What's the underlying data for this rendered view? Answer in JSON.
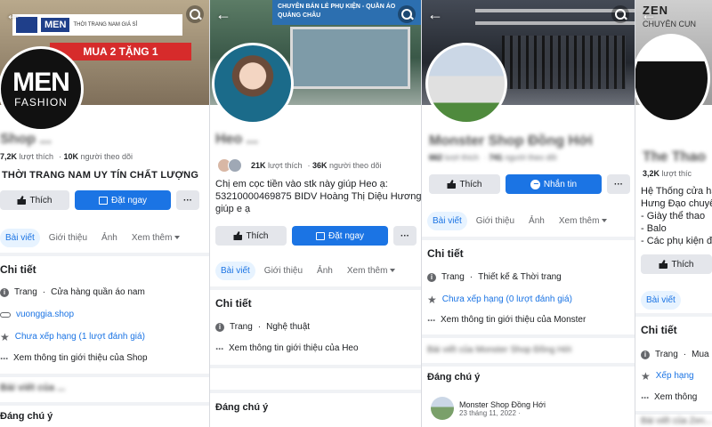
{
  "panels": [
    {
      "cover_sign_brand": "MEN",
      "cover_sign_text": "THỜI TRANG NAM GIÁ SỈ",
      "cover_promo": "MUA 2 TẶNG 1",
      "avatar_line1": "MEN",
      "avatar_line2": "FASHION",
      "page_name": "Shop ...",
      "likes_count": "7,2K",
      "likes_label": "lượt thích",
      "followers_count": "10K",
      "followers_label": "người theo dõi",
      "intro": "THỜI TRANG NAM UY TÍN CHẤT LƯỢNG",
      "like_btn": "Thích",
      "primary_btn": "Đặt ngay",
      "more_btn": "···",
      "tabs": [
        "Bài viết",
        "Giới thiệu",
        "Ảnh",
        "Xem thêm"
      ],
      "details_title": "Chi tiết",
      "details": {
        "category_prefix": "Trang",
        "category": "Cửa hàng quần áo nam",
        "website": "vuonggia.shop",
        "rating": "Chưa xếp hạng (1 lượt đánh giá)",
        "see_more": "Xem thông tin giới thiệu của Shop"
      },
      "posts_title": "Bài viết của ...",
      "notable_title": "Đáng chú ý"
    },
    {
      "cover_sign_text": "CHUYÊN BÁN LẺ PHỤ KIỆN - QUẦN ÁO QUẢNG CHÂU",
      "page_name": "Heo ...",
      "likes_count": "21K",
      "likes_label": "lượt thích",
      "followers_count": "36K",
      "followers_label": "người theo dõi",
      "intro_lines": [
        "Chị em cọc tiền vào stk này giúp Heo ạ:",
        "53210000469875 BIDV Hoàng Thị Diệu Hương",
        "giúp e ạ"
      ],
      "like_btn": "Thích",
      "primary_btn": "Đặt ngay",
      "more_btn": "···",
      "tabs": [
        "Bài viết",
        "Giới thiệu",
        "Ảnh",
        "Xem thêm"
      ],
      "details_title": "Chi tiết",
      "details": {
        "category_prefix": "Trang",
        "category": "Nghệ thuật",
        "see_more": "Xem thông tin giới thiệu của Heo"
      },
      "notable_title": "Đáng chú ý"
    },
    {
      "page_name": "Monster Shop Đồng Hới",
      "likes_count": "662",
      "likes_label": "lượt thích",
      "followers_count": "741",
      "followers_label": "người theo dõi",
      "like_btn": "Thích",
      "primary_btn": "Nhắn tin",
      "more_btn": "···",
      "tabs": [
        "Bài viết",
        "Giới thiệu",
        "Ảnh",
        "Xem thêm"
      ],
      "details_title": "Chi tiết",
      "details": {
        "category_prefix": "Trang",
        "category": "Thiết kế & Thời trang",
        "rating": "Chưa xếp hạng (0 lượt đánh giá)",
        "see_more": "Xem thông tin giới thiệu của Monster"
      },
      "posts_title": "Bài viết của Monster Shop Đồng Hới",
      "notable_title": "Đáng chú ý",
      "post_name": "Monster Shop Đồng Hới",
      "post_date": "23 tháng 11, 2022 ·"
    },
    {
      "cover_brand": "ZEN",
      "cover_slogan": "CHUYÊN CUN",
      "page_name": "The Thao",
      "likes_count": "3,2K",
      "likes_label": "lượt thíc",
      "intro_lines": [
        "Hệ Thống cửa hà",
        "Hưng Đạo chuyê",
        "- Giày thể thao",
        "- Balo",
        "- Các phụ kiện đ"
      ],
      "like_btn": "Thích",
      "tabs": [
        "Bài viết"
      ],
      "details_title": "Chi tiết",
      "details": {
        "category_prefix": "Trang",
        "category": "Mua",
        "rating": "Xếp hạng",
        "see_more": "Xem thông"
      },
      "posts_title": "Bài viết của Zen..."
    }
  ]
}
